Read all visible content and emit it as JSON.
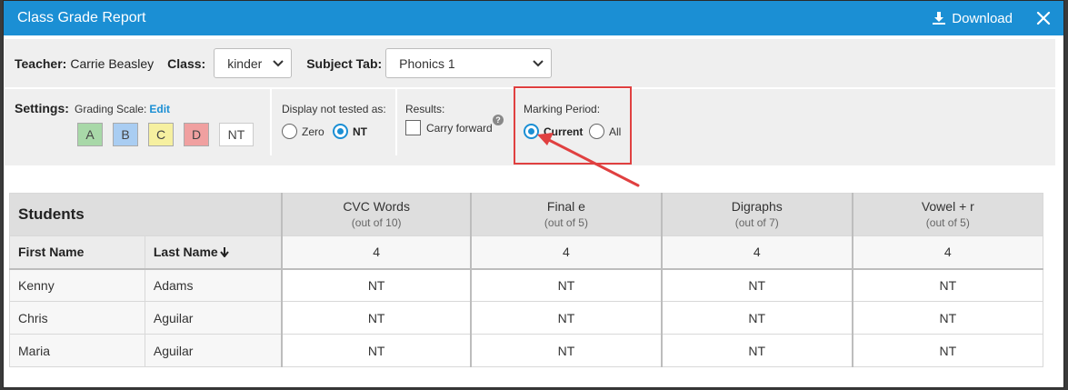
{
  "window": {
    "title": "Class Grade Report",
    "download_label": "Download"
  },
  "filters": {
    "teacher_label": "Teacher:",
    "teacher_value": "Carrie Beasley",
    "class_label": "Class:",
    "class_value": "kinder",
    "subject_label": "Subject Tab:",
    "subject_value": "Phonics 1"
  },
  "settings": {
    "label": "Settings:",
    "grading_scale_label": "Grading Scale:",
    "edit_label": "Edit",
    "swatches": [
      {
        "label": "A",
        "color": "#a8d8a8"
      },
      {
        "label": "B",
        "color": "#a9cdf2"
      },
      {
        "label": "C",
        "color": "#f6f0a0"
      },
      {
        "label": "D",
        "color": "#f0a0a0"
      },
      {
        "label": "NT",
        "color": "#ffffff"
      }
    ],
    "display_not_tested_label": "Display not tested as:",
    "display_options": [
      {
        "label": "Zero",
        "selected": false
      },
      {
        "label": "NT",
        "selected": true
      }
    ],
    "results_label": "Results:",
    "carry_forward_label": "Carry forward",
    "carry_forward_checked": false,
    "marking_period_label": "Marking Period:",
    "marking_options": [
      {
        "label": "Current",
        "selected": true
      },
      {
        "label": "All",
        "selected": false
      }
    ]
  },
  "table": {
    "students_label": "Students",
    "first_name_label": "First Name",
    "last_name_label": "Last Name",
    "columns": [
      {
        "name": "CVC Words",
        "sub": "(out of 10)",
        "count": "4"
      },
      {
        "name": "Final e",
        "sub": "(out of 5)",
        "count": "4"
      },
      {
        "name": "Digraphs",
        "sub": "(out of 7)",
        "count": "4"
      },
      {
        "name": "Vowel + r",
        "sub": "(out of 5)",
        "count": "4"
      }
    ],
    "rows": [
      {
        "first": "Kenny",
        "last": "Adams",
        "scores": [
          "NT",
          "NT",
          "NT",
          "NT"
        ]
      },
      {
        "first": "Chris",
        "last": "Aguilar",
        "scores": [
          "NT",
          "NT",
          "NT",
          "NT"
        ]
      },
      {
        "first": "Maria",
        "last": "Aguilar",
        "scores": [
          "NT",
          "NT",
          "NT",
          "NT"
        ]
      }
    ]
  },
  "colors": {
    "accent": "#1b8fd4",
    "annotation": "#e04040"
  }
}
